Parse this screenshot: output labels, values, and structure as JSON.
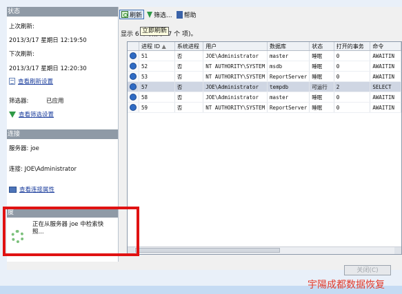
{
  "left": {
    "status_header": "状态",
    "last_refresh_label": "上次刷新:",
    "last_refresh_value": "2013/3/17 星期日 12:19:50",
    "next_refresh_label": "下次刷新:",
    "next_refresh_value": "2013/3/17 星期日 12:20:30",
    "view_refresh_link": "查看刷新设置",
    "filter_label": "筛选器:",
    "filter_value": "已应用",
    "view_filter_link": "查看筛选设置",
    "connection_header": "连接",
    "server_label": "服务器: joe",
    "connection_label": "连接: JOE\\Administrator",
    "view_conn_link": "查看连接属性",
    "progress_header": "度",
    "progress_text": "正在从服务器 joe 中检索快照..."
  },
  "toolbar": {
    "refresh": "刷新",
    "filter": "筛选...",
    "help": "帮助",
    "tooltip": "立即刷新"
  },
  "count_text": "显示 6 个项(共 27 个 项)。",
  "grid": {
    "columns": [
      "进程 ID",
      "系统进程",
      "用户",
      "数据库",
      "状态",
      "打开的事务",
      "命令"
    ],
    "rows": [
      [
        "51",
        "否",
        "JOE\\Administrator",
        "master",
        "睡眠",
        "0",
        "AWAITIN"
      ],
      [
        "52",
        "否",
        "NT AUTHORITY\\SYSTEM",
        "msdb",
        "睡眠",
        "0",
        "AWAITIN"
      ],
      [
        "53",
        "否",
        "NT AUTHORITY\\SYSTEM",
        "ReportServer",
        "睡眠",
        "0",
        "AWAITIN"
      ],
      [
        "57",
        "否",
        "JOE\\Administrator",
        "tempdb",
        "可运行",
        "2",
        "SELECT"
      ],
      [
        "58",
        "否",
        "JOE\\Administrator",
        "master",
        "睡眠",
        "0",
        "AWAITIN"
      ],
      [
        "59",
        "否",
        "NT AUTHORITY\\SYSTEM",
        "ReportServer",
        "睡眠",
        "0",
        "AWAITIN"
      ]
    ],
    "selected_row": 3
  },
  "close_button": "关闭(C)",
  "watermark": "宇陽成都数据恢复",
  "colors": {
    "highlight": "#e01212",
    "selected_row": "#cfd6e3",
    "link": "#1a3c9c"
  }
}
